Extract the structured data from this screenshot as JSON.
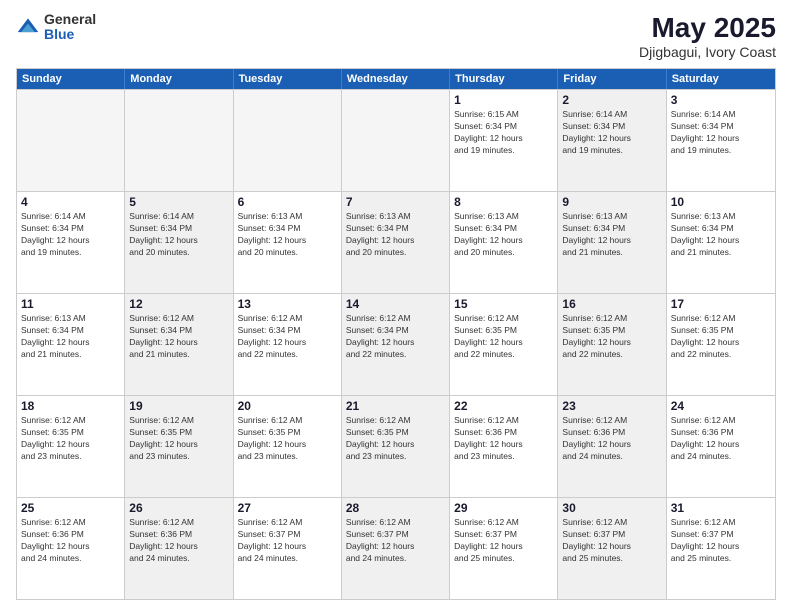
{
  "header": {
    "logo_general": "General",
    "logo_blue": "Blue",
    "title": "May 2025",
    "subtitle": "Djigbagui, Ivory Coast"
  },
  "calendar": {
    "days_of_week": [
      "Sunday",
      "Monday",
      "Tuesday",
      "Wednesday",
      "Thursday",
      "Friday",
      "Saturday"
    ],
    "rows": [
      [
        {
          "day": "",
          "info": "",
          "empty": true
        },
        {
          "day": "",
          "info": "",
          "empty": true
        },
        {
          "day": "",
          "info": "",
          "empty": true
        },
        {
          "day": "",
          "info": "",
          "empty": true
        },
        {
          "day": "1",
          "info": "Sunrise: 6:15 AM\nSunset: 6:34 PM\nDaylight: 12 hours\nand 19 minutes."
        },
        {
          "day": "2",
          "info": "Sunrise: 6:14 AM\nSunset: 6:34 PM\nDaylight: 12 hours\nand 19 minutes.",
          "shaded": true
        },
        {
          "day": "3",
          "info": "Sunrise: 6:14 AM\nSunset: 6:34 PM\nDaylight: 12 hours\nand 19 minutes."
        }
      ],
      [
        {
          "day": "4",
          "info": "Sunrise: 6:14 AM\nSunset: 6:34 PM\nDaylight: 12 hours\nand 19 minutes."
        },
        {
          "day": "5",
          "info": "Sunrise: 6:14 AM\nSunset: 6:34 PM\nDaylight: 12 hours\nand 20 minutes.",
          "shaded": true
        },
        {
          "day": "6",
          "info": "Sunrise: 6:13 AM\nSunset: 6:34 PM\nDaylight: 12 hours\nand 20 minutes."
        },
        {
          "day": "7",
          "info": "Sunrise: 6:13 AM\nSunset: 6:34 PM\nDaylight: 12 hours\nand 20 minutes.",
          "shaded": true
        },
        {
          "day": "8",
          "info": "Sunrise: 6:13 AM\nSunset: 6:34 PM\nDaylight: 12 hours\nand 20 minutes."
        },
        {
          "day": "9",
          "info": "Sunrise: 6:13 AM\nSunset: 6:34 PM\nDaylight: 12 hours\nand 21 minutes.",
          "shaded": true
        },
        {
          "day": "10",
          "info": "Sunrise: 6:13 AM\nSunset: 6:34 PM\nDaylight: 12 hours\nand 21 minutes."
        }
      ],
      [
        {
          "day": "11",
          "info": "Sunrise: 6:13 AM\nSunset: 6:34 PM\nDaylight: 12 hours\nand 21 minutes."
        },
        {
          "day": "12",
          "info": "Sunrise: 6:12 AM\nSunset: 6:34 PM\nDaylight: 12 hours\nand 21 minutes.",
          "shaded": true
        },
        {
          "day": "13",
          "info": "Sunrise: 6:12 AM\nSunset: 6:34 PM\nDaylight: 12 hours\nand 22 minutes."
        },
        {
          "day": "14",
          "info": "Sunrise: 6:12 AM\nSunset: 6:34 PM\nDaylight: 12 hours\nand 22 minutes.",
          "shaded": true
        },
        {
          "day": "15",
          "info": "Sunrise: 6:12 AM\nSunset: 6:35 PM\nDaylight: 12 hours\nand 22 minutes."
        },
        {
          "day": "16",
          "info": "Sunrise: 6:12 AM\nSunset: 6:35 PM\nDaylight: 12 hours\nand 22 minutes.",
          "shaded": true
        },
        {
          "day": "17",
          "info": "Sunrise: 6:12 AM\nSunset: 6:35 PM\nDaylight: 12 hours\nand 22 minutes."
        }
      ],
      [
        {
          "day": "18",
          "info": "Sunrise: 6:12 AM\nSunset: 6:35 PM\nDaylight: 12 hours\nand 23 minutes."
        },
        {
          "day": "19",
          "info": "Sunrise: 6:12 AM\nSunset: 6:35 PM\nDaylight: 12 hours\nand 23 minutes.",
          "shaded": true
        },
        {
          "day": "20",
          "info": "Sunrise: 6:12 AM\nSunset: 6:35 PM\nDaylight: 12 hours\nand 23 minutes."
        },
        {
          "day": "21",
          "info": "Sunrise: 6:12 AM\nSunset: 6:35 PM\nDaylight: 12 hours\nand 23 minutes.",
          "shaded": true
        },
        {
          "day": "22",
          "info": "Sunrise: 6:12 AM\nSunset: 6:36 PM\nDaylight: 12 hours\nand 23 minutes."
        },
        {
          "day": "23",
          "info": "Sunrise: 6:12 AM\nSunset: 6:36 PM\nDaylight: 12 hours\nand 24 minutes.",
          "shaded": true
        },
        {
          "day": "24",
          "info": "Sunrise: 6:12 AM\nSunset: 6:36 PM\nDaylight: 12 hours\nand 24 minutes."
        }
      ],
      [
        {
          "day": "25",
          "info": "Sunrise: 6:12 AM\nSunset: 6:36 PM\nDaylight: 12 hours\nand 24 minutes."
        },
        {
          "day": "26",
          "info": "Sunrise: 6:12 AM\nSunset: 6:36 PM\nDaylight: 12 hours\nand 24 minutes.",
          "shaded": true
        },
        {
          "day": "27",
          "info": "Sunrise: 6:12 AM\nSunset: 6:37 PM\nDaylight: 12 hours\nand 24 minutes."
        },
        {
          "day": "28",
          "info": "Sunrise: 6:12 AM\nSunset: 6:37 PM\nDaylight: 12 hours\nand 24 minutes.",
          "shaded": true
        },
        {
          "day": "29",
          "info": "Sunrise: 6:12 AM\nSunset: 6:37 PM\nDaylight: 12 hours\nand 25 minutes."
        },
        {
          "day": "30",
          "info": "Sunrise: 6:12 AM\nSunset: 6:37 PM\nDaylight: 12 hours\nand 25 minutes.",
          "shaded": true
        },
        {
          "day": "31",
          "info": "Sunrise: 6:12 AM\nSunset: 6:37 PM\nDaylight: 12 hours\nand 25 minutes."
        }
      ]
    ]
  }
}
